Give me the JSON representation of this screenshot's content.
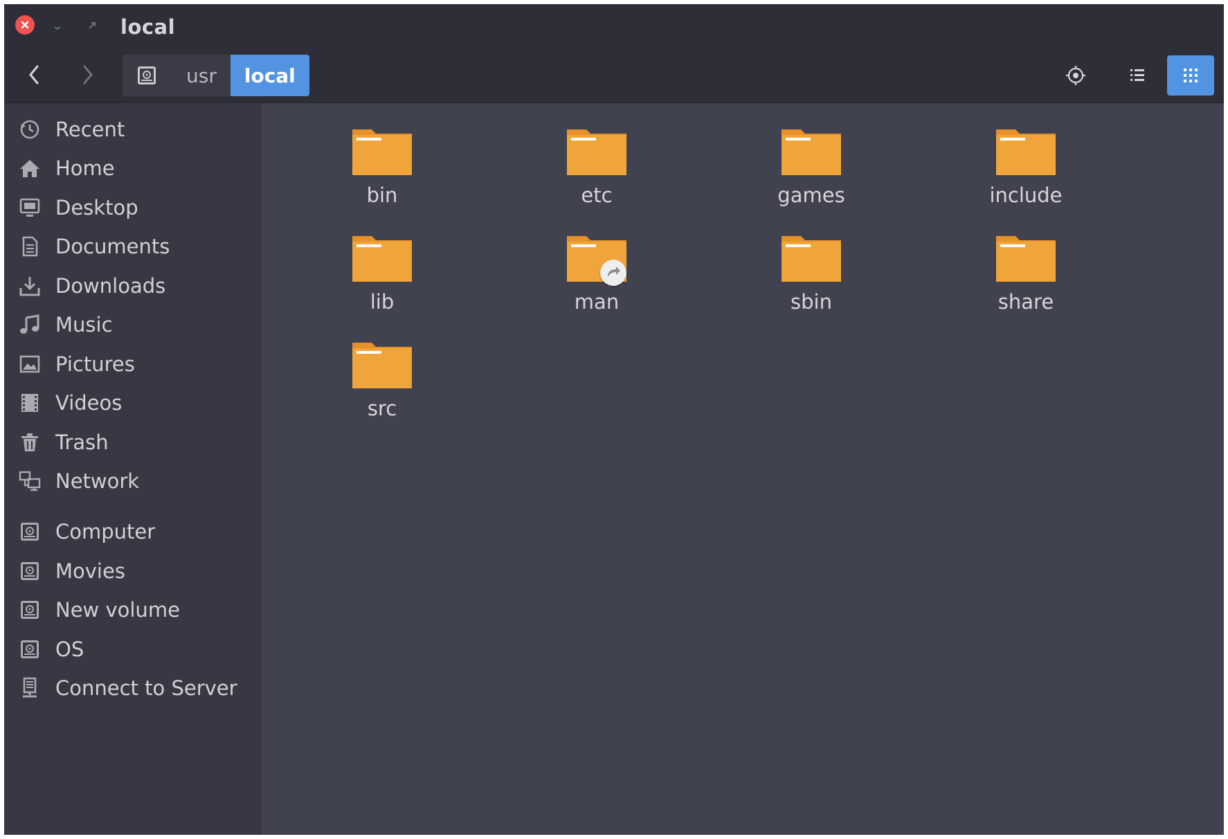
{
  "window": {
    "title": "local"
  },
  "titlebar": {
    "close_icon": "close-icon",
    "minimize_icon": "minimize-icon",
    "maximize_icon": "maximize-icon"
  },
  "toolbar": {
    "back_icon": "chevron-left-icon",
    "forward_icon": "chevron-right-icon",
    "breadcrumbs": [
      {
        "icon": "drive-icon",
        "label": ""
      },
      {
        "label": "usr"
      },
      {
        "label": "local",
        "active": true
      }
    ],
    "locate_icon": "locate-icon",
    "list_view_icon": "list-view-icon",
    "grid_view_icon": "grid-view-icon",
    "view_mode": "grid"
  },
  "sidebar": {
    "items": [
      {
        "label": "Recent",
        "icon": "clock-icon"
      },
      {
        "label": "Home",
        "icon": "home-icon"
      },
      {
        "label": "Desktop",
        "icon": "desktop-icon"
      },
      {
        "label": "Documents",
        "icon": "document-icon"
      },
      {
        "label": "Downloads",
        "icon": "download-icon"
      },
      {
        "label": "Music",
        "icon": "music-icon"
      },
      {
        "label": "Pictures",
        "icon": "picture-icon"
      },
      {
        "label": "Videos",
        "icon": "video-icon"
      },
      {
        "label": "Trash",
        "icon": "trash-icon"
      },
      {
        "label": "Network",
        "icon": "network-icon"
      },
      {
        "label": "Computer",
        "icon": "drive-icon"
      },
      {
        "label": "Movies",
        "icon": "drive-icon"
      },
      {
        "label": "New volume",
        "icon": "drive-icon"
      },
      {
        "label": "OS",
        "icon": "drive-icon"
      },
      {
        "label": "Connect to Server",
        "icon": "server-icon"
      }
    ]
  },
  "files": [
    {
      "name": "bin",
      "icon": "folder-icon"
    },
    {
      "name": "etc",
      "icon": "folder-icon"
    },
    {
      "name": "games",
      "icon": "folder-icon"
    },
    {
      "name": "include",
      "icon": "folder-icon"
    },
    {
      "name": "lib",
      "icon": "folder-icon"
    },
    {
      "name": "man",
      "icon": "folder-icon",
      "emblem": "symlink-icon"
    },
    {
      "name": "sbin",
      "icon": "folder-icon"
    },
    {
      "name": "share",
      "icon": "folder-icon"
    },
    {
      "name": "src",
      "icon": "folder-icon"
    }
  ],
  "colors": {
    "accent": "#5294e2",
    "folder": "#f0a53a",
    "folder_tab": "#e8902a",
    "background": "#41424f",
    "sidebar": "#373843",
    "headerbar": "#2d2e38",
    "close": "#ef5350"
  }
}
